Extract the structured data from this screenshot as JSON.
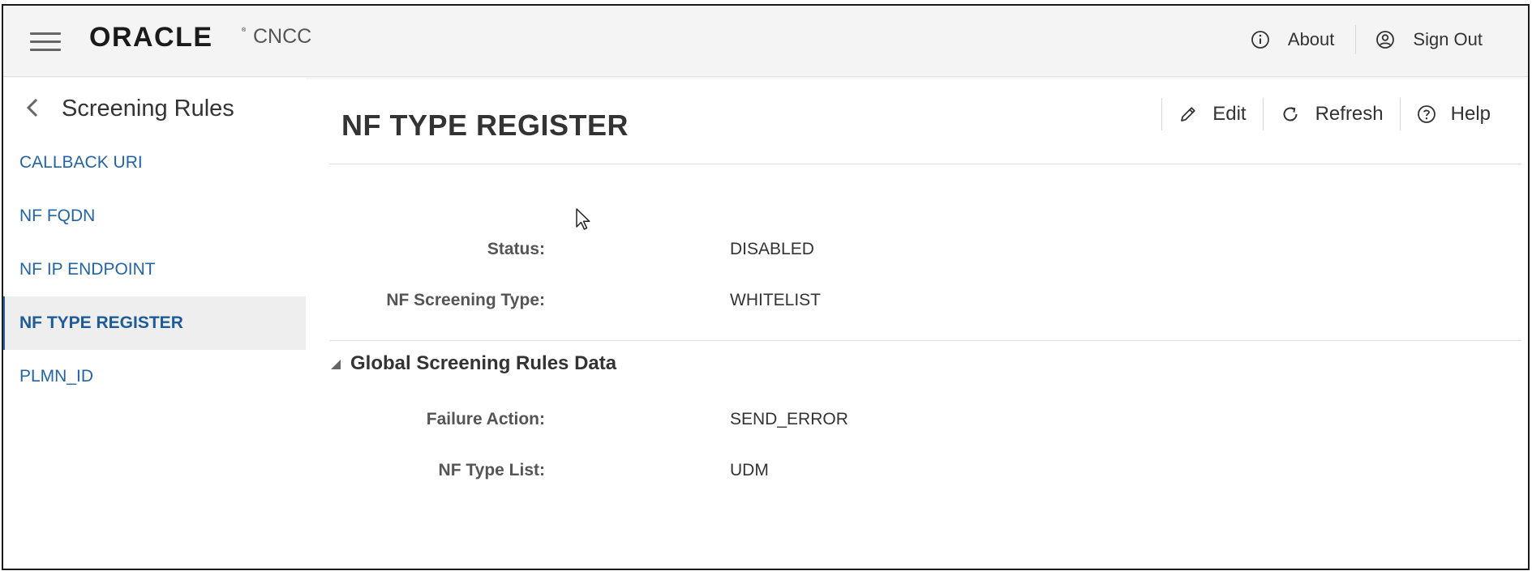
{
  "header": {
    "brand": "ORACLE",
    "product": "CNCC",
    "about_label": "About",
    "signout_label": "Sign Out"
  },
  "sidebar": {
    "title": "Screening Rules",
    "items": [
      {
        "label": "CALLBACK URI"
      },
      {
        "label": "NF FQDN"
      },
      {
        "label": "NF IP ENDPOINT"
      },
      {
        "label": "NF TYPE REGISTER",
        "active": true
      },
      {
        "label": "PLMN_ID"
      }
    ]
  },
  "main": {
    "title": "NF TYPE REGISTER",
    "toolbar": {
      "edit_label": "Edit",
      "refresh_label": "Refresh",
      "help_label": "Help"
    },
    "fields": [
      {
        "label": "Status:",
        "value": "DISABLED"
      },
      {
        "label": "NF Screening Type:",
        "value": "WHITELIST"
      }
    ],
    "section": {
      "title": "Global Screening Rules Data",
      "fields": [
        {
          "label": "Failure Action:",
          "value": "SEND_ERROR"
        },
        {
          "label": "NF Type List:",
          "value": "UDM"
        }
      ]
    }
  },
  "icons": {
    "menu": "hamburger-icon",
    "about": "info-circle-icon",
    "signout": "user-circle-icon",
    "back": "chevron-left-icon",
    "edit": "pencil-icon",
    "refresh": "refresh-icon",
    "help": "question-circle-icon",
    "collapse": "triangle-expanded-icon"
  },
  "colors": {
    "link": "#2364a4",
    "header_bg": "#f4f4f4",
    "active_item_bg": "#eeeeee"
  }
}
